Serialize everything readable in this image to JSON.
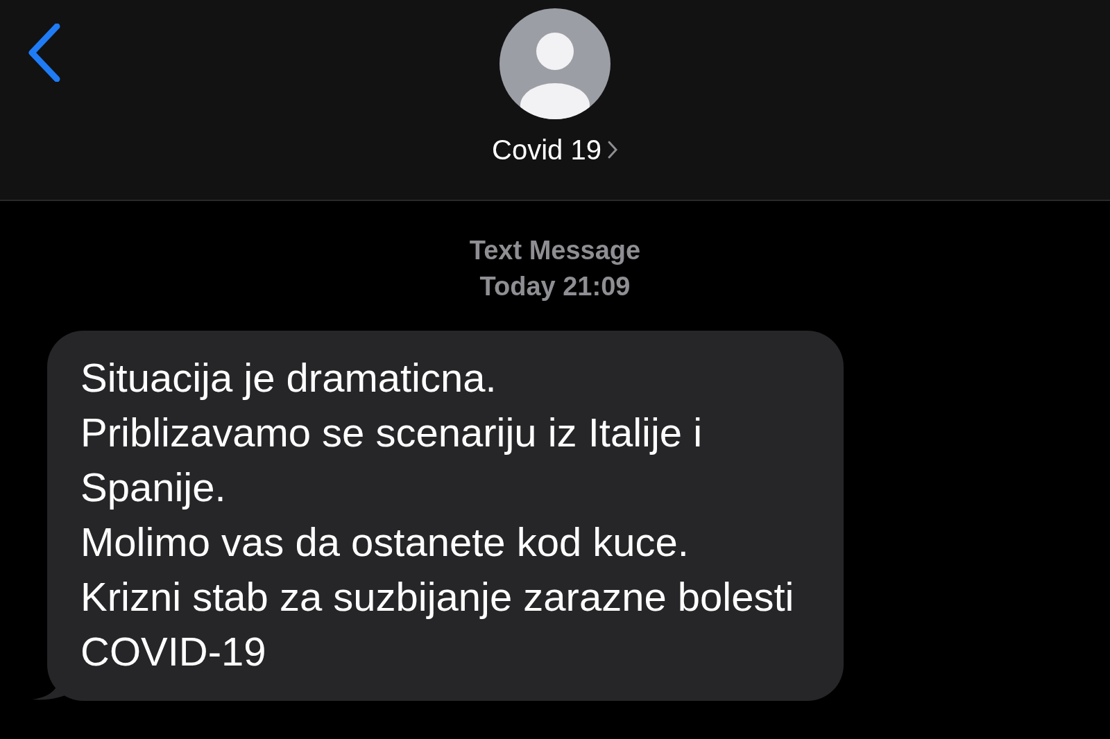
{
  "header": {
    "contact_name": "Covid 19"
  },
  "conversation": {
    "service": "Text Message",
    "timestamp": "Today 21:09"
  },
  "messages": [
    {
      "kind": "received",
      "lines": [
        "Situacija je dramaticna.",
        "Priblizavamo se scenariju iz Italije i Spanije.",
        "Molimo vas da ostanete kod kuce.",
        "Krizni stab za suzbijanje zarazne bolesti COVID-19"
      ]
    }
  ]
}
